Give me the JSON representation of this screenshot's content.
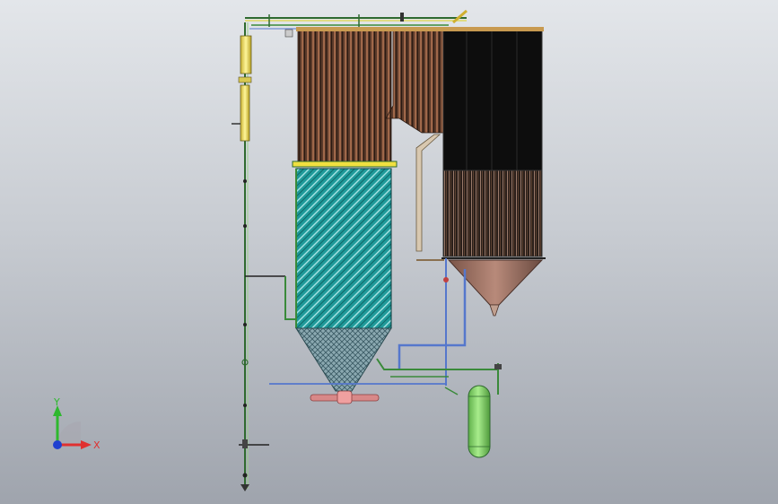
{
  "triad": {
    "x_label": "X",
    "y_label": "Y",
    "x_color": "#e03030",
    "y_color": "#2eb82e",
    "z_color": "#2040d0"
  },
  "colors": {
    "furnace_fill": "#1f9a9a",
    "furnace_hatch": "#8fd8d8",
    "tube_bank_dark": "#4a2f22",
    "tube_bank_light": "#a07050",
    "convection_dark": "#111111",
    "hopper_fill": "#a6786a",
    "vessel_green": "#8ad870",
    "pipe_blue": "#5577cc",
    "pipe_green": "#3a8a3a",
    "yellow_pipe": "#f0e060"
  },
  "assembly": {
    "components": [
      "downcomer-riser-column",
      "upper-water-wall-section",
      "furnace-lower-section",
      "furnace-hopper",
      "superheater-section",
      "convection-pass",
      "ash-hopper",
      "separator-vessel",
      "bottom-valve"
    ]
  }
}
